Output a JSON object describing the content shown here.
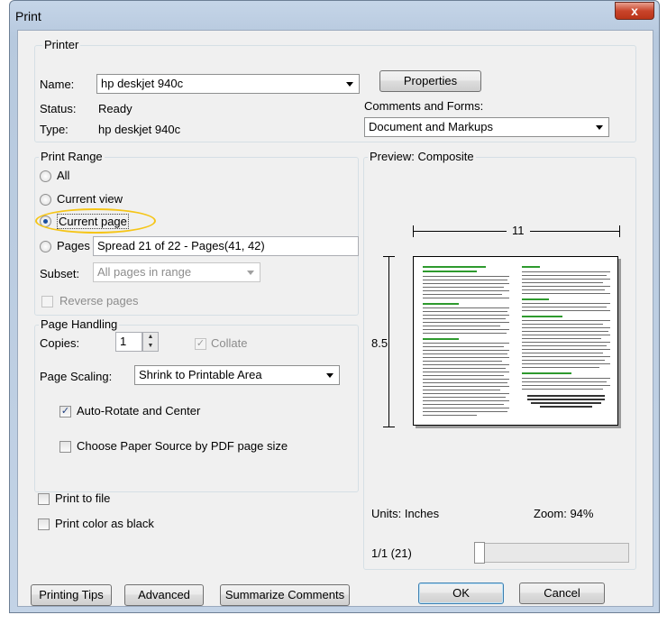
{
  "window": {
    "title": "Print",
    "close_glyph": "x"
  },
  "printer": {
    "group_label": "Printer",
    "name_label": "Name:",
    "name_value": "hp deskjet 940c",
    "status_label": "Status:",
    "status_value": "Ready",
    "type_label": "Type:",
    "type_value": "hp deskjet 940c",
    "properties_button": "Properties",
    "comments_label": "Comments and Forms:",
    "comments_value": "Document and Markups"
  },
  "print_range": {
    "group_label": "Print Range",
    "options": [
      "All",
      "Current view",
      "Current page",
      "Pages"
    ],
    "selected": "Current page",
    "pages_value": "Spread 21 of 22 - Pages(41, 42)",
    "subset_label": "Subset:",
    "subset_value": "All pages in range",
    "reverse_label": "Reverse pages"
  },
  "page_handling": {
    "group_label": "Page Handling",
    "copies_label": "Copies:",
    "copies_value": "1",
    "collate_label": "Collate",
    "scaling_label": "Page Scaling:",
    "scaling_value": "Shrink to Printable Area",
    "auto_rotate_label": "Auto-Rotate and Center",
    "auto_rotate_checked": true,
    "paper_source_label": "Choose Paper Source by PDF page size",
    "paper_source_checked": false
  },
  "options": {
    "print_to_file_label": "Print to file",
    "print_color_black_label": "Print color as black"
  },
  "preview": {
    "label": "Preview: Composite",
    "width_label": "11",
    "height_label": "8.5",
    "units_label": "Units: Inches",
    "zoom_label": "Zoom:  94%",
    "page_indicator": "1/1 (21)"
  },
  "buttons": {
    "printing_tips": "Printing Tips",
    "advanced": "Advanced",
    "summarize": "Summarize Comments",
    "ok": "OK",
    "cancel": "Cancel"
  },
  "colors": {
    "highlight_ellipse": "#f5c518",
    "radio_dot": "#1a4fa0",
    "preview_heading_green": "#2e9a2e"
  }
}
